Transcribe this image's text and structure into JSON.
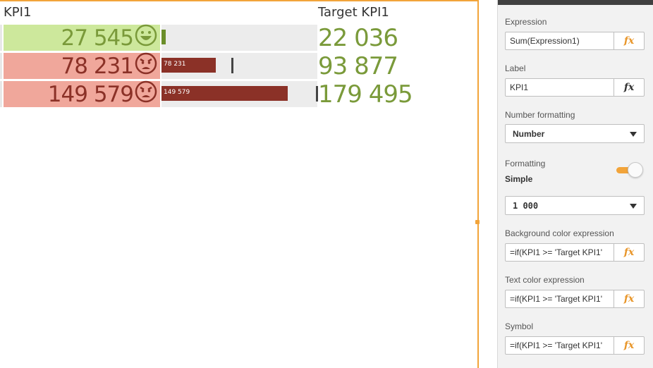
{
  "table": {
    "headers": {
      "kpi": "KPI1",
      "target": "Target KPI1"
    },
    "rows": [
      {
        "kpi_value": "27 545",
        "status": "good",
        "symbol": "smile-icon",
        "bar_label": "",
        "bar_fraction": 0.02,
        "marker_fraction": 0.0,
        "target": "22 036",
        "bg_color": "#cde89c",
        "text_color": "#7a9a3a"
      },
      {
        "kpi_value": "78 231",
        "status": "bad",
        "symbol": "angry-icon",
        "bar_label": "78 231",
        "bar_fraction": 0.35,
        "marker_fraction": 0.45,
        "target": "93 877",
        "bg_color": "#f0a79b",
        "text_color": "#8b3127"
      },
      {
        "kpi_value": "149 579",
        "status": "bad",
        "symbol": "angry-icon",
        "bar_label": "149 579",
        "bar_fraction": 0.81,
        "marker_fraction": 0.99,
        "target": "179 495",
        "bg_color": "#f0a79b",
        "text_color": "#8b3127"
      }
    ]
  },
  "properties": {
    "expression": {
      "label": "Expression",
      "value": "Sum(Expression1)"
    },
    "label": {
      "label": "Label",
      "value": "KPI1"
    },
    "number_formatting": {
      "label": "Number formatting",
      "value": "Number"
    },
    "formatting": {
      "label": "Formatting",
      "mode": "Simple",
      "toggle_on": true
    },
    "format_pattern": {
      "value": "1 000"
    },
    "background_color": {
      "label": "Background color expression",
      "value": "=if(KPI1 >= 'Target KPI1'"
    },
    "text_color": {
      "label": "Text color expression",
      "value": "=if(KPI1 >= 'Target KPI1'"
    },
    "symbol": {
      "label": "Symbol",
      "value": "=if(KPI1 >= 'Target KPI1'"
    }
  },
  "colors": {
    "accent": "#f2a43a",
    "good_text": "#7a9a3a",
    "bad_text": "#8b3127",
    "fx_orange": "#e8962a"
  }
}
